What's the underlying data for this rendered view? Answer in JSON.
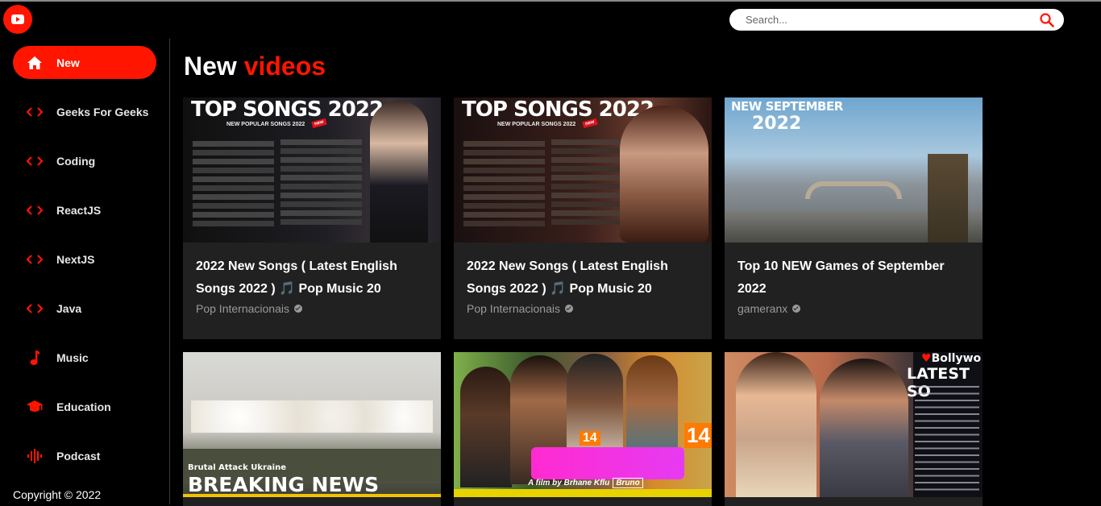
{
  "app": {
    "logo_icon": "play-icon",
    "accent": "#ff1500"
  },
  "search": {
    "placeholder": "Search...",
    "icon": "search-icon"
  },
  "sidebar": {
    "items": [
      {
        "label": "New",
        "icon": "home-icon",
        "active": true
      },
      {
        "label": "Geeks For Geeks",
        "icon": "code-icon"
      },
      {
        "label": "Coding",
        "icon": "code-icon"
      },
      {
        "label": "ReactJS",
        "icon": "code-icon"
      },
      {
        "label": "NextJS",
        "icon": "code-icon"
      },
      {
        "label": "Java",
        "icon": "code-icon"
      },
      {
        "label": "Music",
        "icon": "music-note-icon"
      },
      {
        "label": "Education",
        "icon": "graduation-cap-icon"
      },
      {
        "label": "Podcast",
        "icon": "podcast-icon"
      }
    ],
    "copyright": "Copyright © 2022"
  },
  "main": {
    "heading": {
      "part1": "New ",
      "part2": "videos"
    },
    "videos": [
      {
        "title": "2022 New Songs ( Latest English Songs 2022 ) 🎵 Pop Music 20",
        "channel": "Pop Internacionais",
        "thumb": {
          "title": "TOP SONGS 2022",
          "subtitle": "NEW POPULAR SONGS 2022",
          "badge": "new"
        }
      },
      {
        "title": "2022 New Songs ( Latest English Songs 2022 ) 🎵 Pop Music 20",
        "channel": "Pop Internacionais",
        "thumb": {
          "title": "TOP SONGS 2022",
          "subtitle": "NEW POPULAR SONGS 2022",
          "badge": "new"
        }
      },
      {
        "title": "Top 10 NEW Games of September 2022",
        "channel": "gameranx",
        "thumb": {
          "title_line1": "NEW SEPTEMBER",
          "title_line2": "2022"
        }
      },
      {
        "thumb": {
          "caption_small": "Brutal Attack Ukraine",
          "caption_big": "BREAKING NEWS"
        }
      },
      {
        "thumb": {
          "badge": "14",
          "film_credit": "A film by Brhane Kflu",
          "credit_box": "Bruno"
        }
      },
      {
        "thumb": {
          "title_line1": "Bollywo",
          "title_line2": "LATEST SO"
        }
      }
    ]
  }
}
